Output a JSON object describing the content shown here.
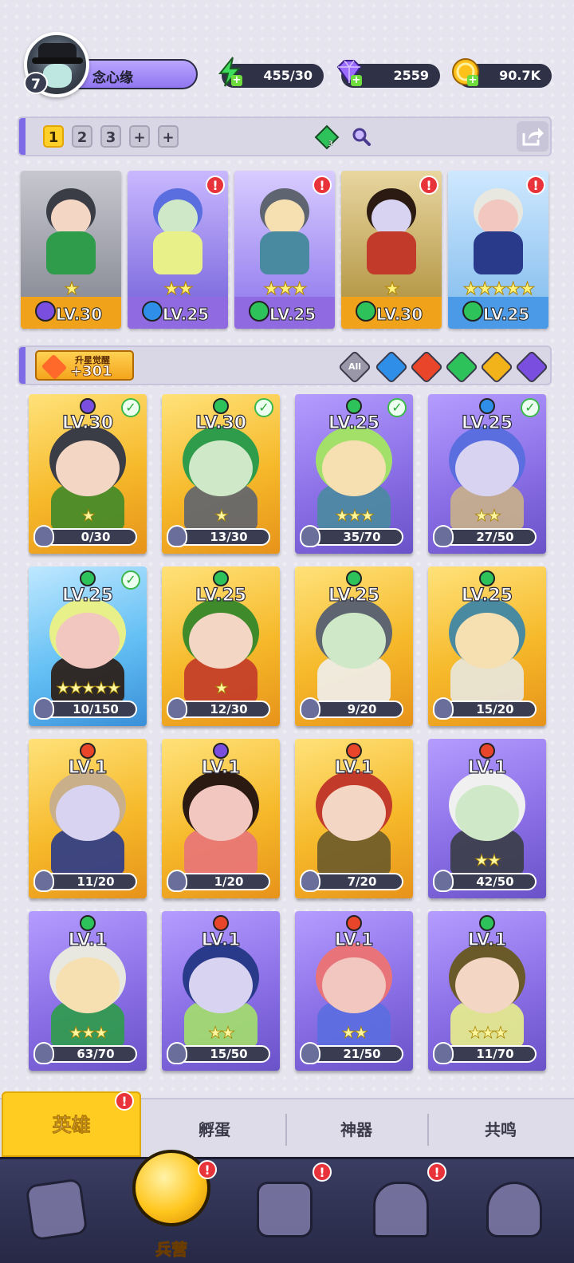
{
  "player": {
    "level": "7",
    "name": "念心缘"
  },
  "resources": {
    "energy": "455/30",
    "gems": "2559",
    "gold": "90.7K"
  },
  "team_tabs": [
    "1",
    "2",
    "3",
    "+",
    "+"
  ],
  "team_gem_count": "3",
  "team": [
    {
      "level": "LV.30",
      "element": "dark",
      "stars": "★",
      "alert": false,
      "foot": "#f0a21a"
    },
    {
      "level": "LV.25",
      "element": "water",
      "stars": "★★",
      "alert": true,
      "foot": "#8f6ae0"
    },
    {
      "level": "LV.25",
      "element": "wind",
      "stars": "★★★",
      "alert": true,
      "foot": "#8f6ae0"
    },
    {
      "level": "LV.30",
      "element": "wind",
      "stars": "★",
      "alert": true,
      "foot": "#f0a21a"
    },
    {
      "level": "LV.25",
      "element": "wind",
      "stars": "★★★★★",
      "alert": true,
      "foot": "#4a9ae8"
    }
  ],
  "alert_mark": "!",
  "awaken": {
    "title": "升星觉醒",
    "value": "+301"
  },
  "filters": [
    "All",
    "water",
    "fire",
    "wind",
    "light",
    "dark"
  ],
  "heroes": [
    {
      "level": "LV.30",
      "element": "dark",
      "progress": "0/30",
      "stars": "★",
      "checked": true,
      "frame": "gold"
    },
    {
      "level": "LV.30",
      "element": "wind",
      "progress": "13/30",
      "stars": "★",
      "checked": true,
      "frame": "gold"
    },
    {
      "level": "LV.25",
      "element": "wind",
      "progress": "35/70",
      "stars": "★★★",
      "checked": true,
      "frame": "purple"
    },
    {
      "level": "LV.25",
      "element": "water",
      "progress": "27/50",
      "stars": "★★",
      "checked": true,
      "frame": "purple"
    },
    {
      "level": "LV.25",
      "element": "wind",
      "progress": "10/150",
      "stars": "★★★★★",
      "checked": true,
      "frame": "blue"
    },
    {
      "level": "LV.25",
      "element": "wind",
      "progress": "12/30",
      "stars": "★",
      "checked": false,
      "frame": "gold"
    },
    {
      "level": "LV.25",
      "element": "wind",
      "progress": "9/20",
      "stars": "",
      "checked": false,
      "frame": "gold"
    },
    {
      "level": "LV.25",
      "element": "wind",
      "progress": "15/20",
      "stars": "",
      "checked": false,
      "frame": "gold"
    },
    {
      "level": "LV.1",
      "element": "fire",
      "progress": "11/20",
      "stars": "",
      "checked": false,
      "frame": "gold"
    },
    {
      "level": "LV.1",
      "element": "dark",
      "progress": "1/20",
      "stars": "",
      "checked": false,
      "frame": "gold"
    },
    {
      "level": "LV.1",
      "element": "fire",
      "progress": "7/20",
      "stars": "",
      "checked": false,
      "frame": "gold"
    },
    {
      "level": "LV.1",
      "element": "fire",
      "progress": "42/50",
      "stars": "★★",
      "checked": false,
      "frame": "purple"
    },
    {
      "level": "LV.1",
      "element": "wind",
      "progress": "63/70",
      "stars": "★★★",
      "checked": false,
      "frame": "purple"
    },
    {
      "level": "LV.1",
      "element": "fire",
      "progress": "15/50",
      "stars": "★★",
      "checked": false,
      "frame": "purple"
    },
    {
      "level": "LV.1",
      "element": "fire",
      "progress": "21/50",
      "stars": "★★",
      "checked": false,
      "frame": "purple"
    },
    {
      "level": "LV.1",
      "element": "wind",
      "progress": "11/70",
      "stars": "★★★",
      "checked": false,
      "frame": "purple"
    }
  ],
  "check_mark": "✓",
  "sub_tabs": [
    "英雄",
    "孵蛋",
    "神器",
    "共鸣"
  ],
  "nav": {
    "active_label": "兵营"
  },
  "colors": {
    "gold_frame": "#f7c531",
    "purple_frame": "#8d76e8",
    "blue_frame": "#55b4f0",
    "water": "#2f8fe8",
    "fire": "#e8452a",
    "wind": "#2ec25a",
    "light": "#f2b21a",
    "dark": "#7a4fe0",
    "accent": "#7c6ae6",
    "alert": "#e8333a"
  }
}
